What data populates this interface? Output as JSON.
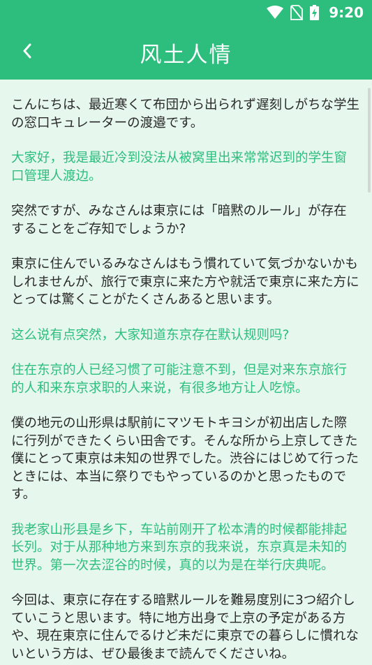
{
  "status_bar": {
    "time": "9:20",
    "icons": [
      "wifi-icon",
      "no-sim-icon",
      "battery-charging-icon"
    ]
  },
  "app_bar": {
    "back_icon": "chevron-left-icon",
    "title": "风土人情"
  },
  "colors": {
    "primary": "#2dbe7e",
    "background": "#e6f7ee",
    "text": "#2a2a2a"
  },
  "paragraphs": [
    {
      "lang": "jp",
      "text": "こんにちは、最近寒くて布団から出られず遅刻しがちな学生の窓口キュレーターの渡邉です。"
    },
    {
      "lang": "cn",
      "text": "大家好，我是最近冷到没法从被窝里出来常常迟到的学生窗口管理人渡边。"
    },
    {
      "lang": "jp",
      "text": "突然ですが、みなさんは東京には「暗黙のルール」が存在することをご存知でしょうか?"
    },
    {
      "lang": "jp",
      "text": "東京に住んでいるみなさんはもう慣れていて気づかないかもしれませんが、旅行で東京に来た方や就活で東京に来た方にとっては驚くことがたくさんあると思います。"
    },
    {
      "lang": "cn",
      "text": "这么说有点突然，大家知道东京存在默认规则吗?"
    },
    {
      "lang": "cn",
      "text": "住在东京的人已经习惯了可能注意不到，但是对来东京旅行的人和来东京求职的人来说，有很多地方让人吃惊。"
    },
    {
      "lang": "jp",
      "text": "僕の地元の山形県は駅前にマツモトキヨシが初出店した際に行列ができたくらい田舎です。そんな所から上京してきた僕にとって東京は未知の世界でした。渋谷にはじめて行ったときには、本当に祭りでもやっているのかと思ったものです。"
    },
    {
      "lang": "cn",
      "text": "我老家山形县是乡下，车站前刚开了松本清的时候都能排起长列。对于从那种地方来到东京的我来说，东京真是未知的世界。第一次去涩谷的时候，真的以为是在举行庆典呢。"
    },
    {
      "lang": "jp",
      "text": "今回は、東京に存在する暗黙ルールを難易度別に3つ紹介していこうと思います。特に地方出身で上京の予定がある方や、現在東京に住んでるけど未だに東京での暮らしに慣れないという方は、ぜひ最後まで読んでくださいね。"
    }
  ]
}
